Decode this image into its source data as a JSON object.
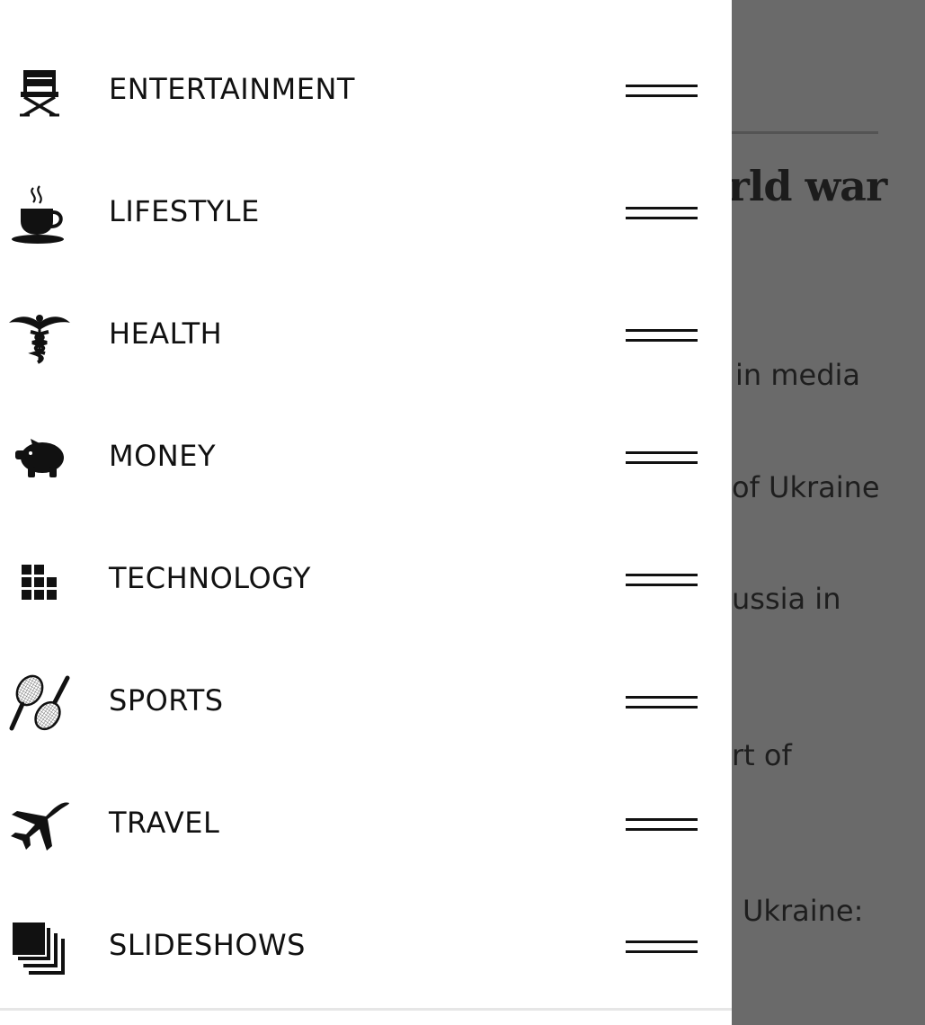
{
  "background_article": {
    "headline_fragment": "orld war",
    "snippets": [
      "in media",
      "of Ukraine",
      "ussia in",
      "rt of",
      "Ukraine:"
    ]
  },
  "menu": {
    "items": [
      {
        "label": "ENTERTAINMENT",
        "icon": "director-chair-icon"
      },
      {
        "label": "LIFESTYLE",
        "icon": "coffee-cup-icon"
      },
      {
        "label": "HEALTH",
        "icon": "caduceus-icon"
      },
      {
        "label": "MONEY",
        "icon": "piggy-bank-icon"
      },
      {
        "label": "TECHNOLOGY",
        "icon": "grid-blocks-icon"
      },
      {
        "label": "SPORTS",
        "icon": "tennis-rackets-icon"
      },
      {
        "label": "TRAVEL",
        "icon": "airplane-icon"
      },
      {
        "label": "SLIDESHOWS",
        "icon": "stacked-squares-icon"
      }
    ]
  },
  "colors": {
    "overlay": "#6a6a6a",
    "drawer": "#ffffff",
    "text": "#111111"
  }
}
